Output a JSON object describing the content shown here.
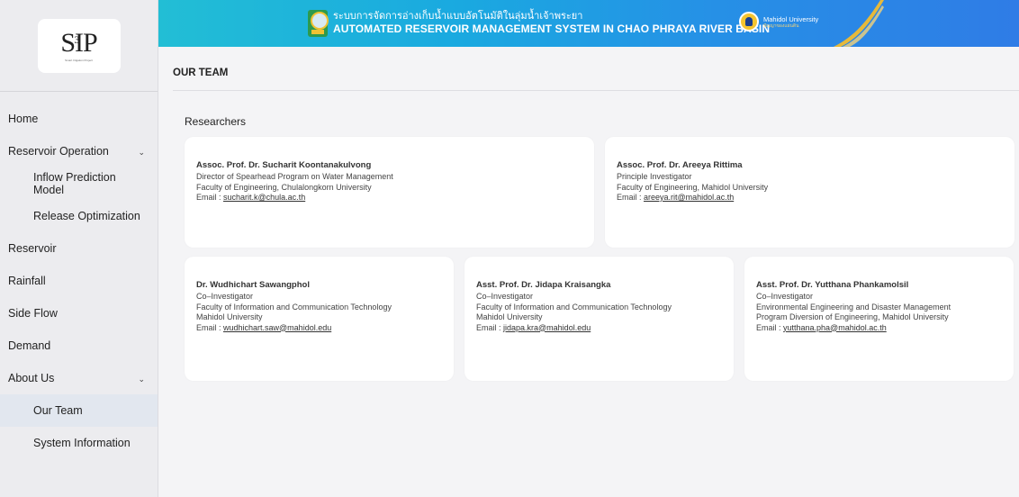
{
  "sidebar": {
    "logo": {
      "text": "SIP",
      "sup": "3",
      "caption": "Smart Irrigation Project"
    },
    "items": [
      {
        "label": "Home",
        "type": "top"
      },
      {
        "label": "Reservoir Operation",
        "type": "top",
        "chevron": "⌄"
      },
      {
        "label": "Inflow Prediction Model",
        "type": "sub"
      },
      {
        "label": "Release Optimization",
        "type": "sub"
      },
      {
        "label": "Reservoir",
        "type": "top"
      },
      {
        "label": "Rainfall",
        "type": "top"
      },
      {
        "label": "Side Flow",
        "type": "top"
      },
      {
        "label": "Demand",
        "type": "top"
      },
      {
        "label": "About Us",
        "type": "top",
        "chevron": "⌄"
      },
      {
        "label": "Our Team",
        "type": "sub",
        "active": true
      },
      {
        "label": "System Information",
        "type": "sub"
      }
    ]
  },
  "header": {
    "title_th": "ระบบการจัดการอ่างเก็บน้ำแบบอัตโนมัติในลุ่มน้ำเจ้าพระยา",
    "title_en": "AUTOMATED RESERVOIR MANAGEMENT SYSTEM IN CHAO PHRAYA RIVER BASIN",
    "university_name": "Mahidol University",
    "university_sub": "ปัญญาของแผ่นดิน",
    "colors": {
      "start": "#22bed5",
      "end": "#2f7ce6"
    }
  },
  "main": {
    "page_title": "OUR TEAM",
    "section_label": "Researchers",
    "researchers_row1": [
      {
        "name": "Assoc. Prof. Dr. Sucharit Koontanakulvong",
        "lines": [
          "Director of Spearhead Program on Water Management",
          "Faculty of Engineering, Chulalongkorn University"
        ],
        "email_label": "Email : ",
        "email": "sucharit.k@chula.ac.th"
      },
      {
        "name": "Assoc. Prof. Dr. Areeya Rittima",
        "lines": [
          "Principle Investigator",
          "Faculty of Engineering, Mahidol University"
        ],
        "email_label": "Email : ",
        "email": "areeya.rit@mahidol.ac.th"
      }
    ],
    "researchers_row2": [
      {
        "name": "Dr. Wudhichart Sawangphol",
        "lines": [
          "Co–Investigator",
          "Faculty of Information and Communication Technology",
          "Mahidol University"
        ],
        "email_label": "Email : ",
        "email": "wudhichart.saw@mahidol.edu"
      },
      {
        "name": "Asst. Prof. Dr. Jidapa Kraisangka",
        "lines": [
          "Co–Investigator",
          "Faculty of Information and Communication Technology",
          "Mahidol University"
        ],
        "email_label": "Email : ",
        "email": "jidapa.kra@mahidol.edu"
      },
      {
        "name": "Asst. Prof. Dr. Yutthana Phankamolsil",
        "lines": [
          "Co–Investigator",
          "Environmental Engineering and Disaster Management",
          "Program Diversion of Engineering, Mahidol University"
        ],
        "email_label": "Email : ",
        "email": "yutthana.pha@mahidol.ac.th"
      }
    ]
  }
}
